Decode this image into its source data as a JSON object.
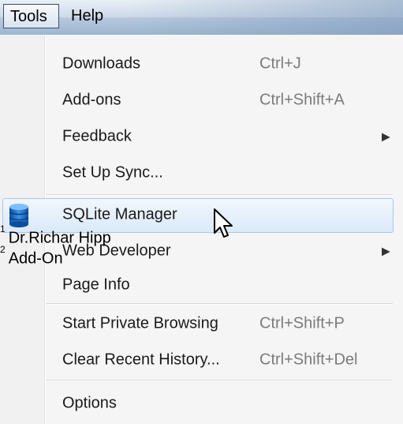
{
  "menubar": {
    "tools_label": "Tools",
    "help_label": "Help"
  },
  "menu": {
    "items": [
      {
        "label": "Downloads",
        "shortcut": "Ctrl+J"
      },
      {
        "label": "Add-ons",
        "shortcut": "Ctrl+Shift+A"
      },
      {
        "label": "Feedback",
        "submenu": true
      },
      {
        "label": "Set Up Sync..."
      },
      {
        "label": "SQLite Manager",
        "icon": "database-icon",
        "highlighted": true
      },
      {
        "label": "Web Developer",
        "submenu": true
      },
      {
        "label": "Page Info"
      },
      {
        "label": "Start Private Browsing",
        "shortcut": "Ctrl+Shift+P"
      },
      {
        "label": "Clear Recent History...",
        "shortcut": "Ctrl+Shift+Del"
      },
      {
        "label": "Options"
      }
    ]
  },
  "annotations": [
    {
      "marker": "1",
      "text": "Dr.Richar Hipp"
    },
    {
      "marker": "2",
      "text": "Add-On"
    }
  ],
  "colors": {
    "highlight": "#dbe9f8",
    "highlight_border": "#a8c8e8",
    "shortcut_text": "#7b7b7b",
    "menubar": "#b6c8dd"
  }
}
